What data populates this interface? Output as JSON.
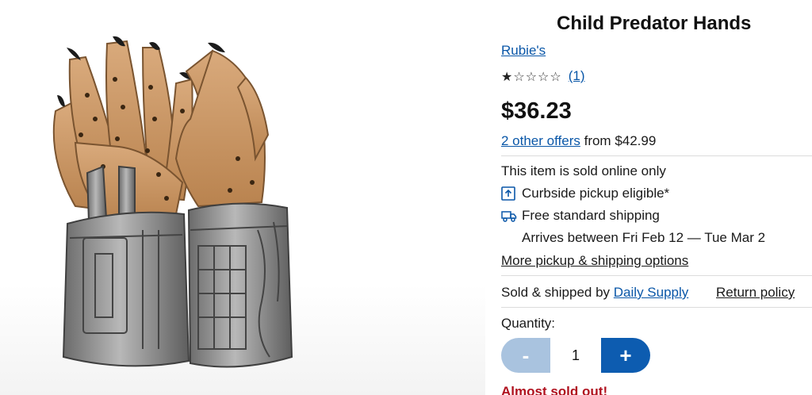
{
  "product": {
    "title": "Child Predator Hands",
    "brand": "Rubie's",
    "rating": {
      "stars": 1,
      "max": 5,
      "count_label": "(1)"
    },
    "price": "$36.23",
    "offers": {
      "link_label": "2 other offers",
      "suffix": "from $42.99"
    }
  },
  "fulfillment": {
    "online_only": "This item is sold online only",
    "curbside": "Curbside pickup eligible*",
    "shipping": "Free standard shipping",
    "arrives": "Arrives between Fri Feb 12 — Tue Mar 2",
    "more_options": "More pickup & shipping options"
  },
  "seller": {
    "prefix": "Sold & shipped by",
    "name": "Daily Supply",
    "return_policy": "Return policy"
  },
  "quantity": {
    "label": "Quantity:",
    "minus": "-",
    "value": "1",
    "plus": "+"
  },
  "stock_warning": "Almost sold out!",
  "colors": {
    "link": "#0a57a8",
    "primary_button": "#0d5cb0",
    "disabled_button": "#a9c3df",
    "warning": "#b0121f"
  },
  "icons": [
    "curbside-pickup-icon",
    "delivery-truck-icon",
    "star-icon"
  ]
}
